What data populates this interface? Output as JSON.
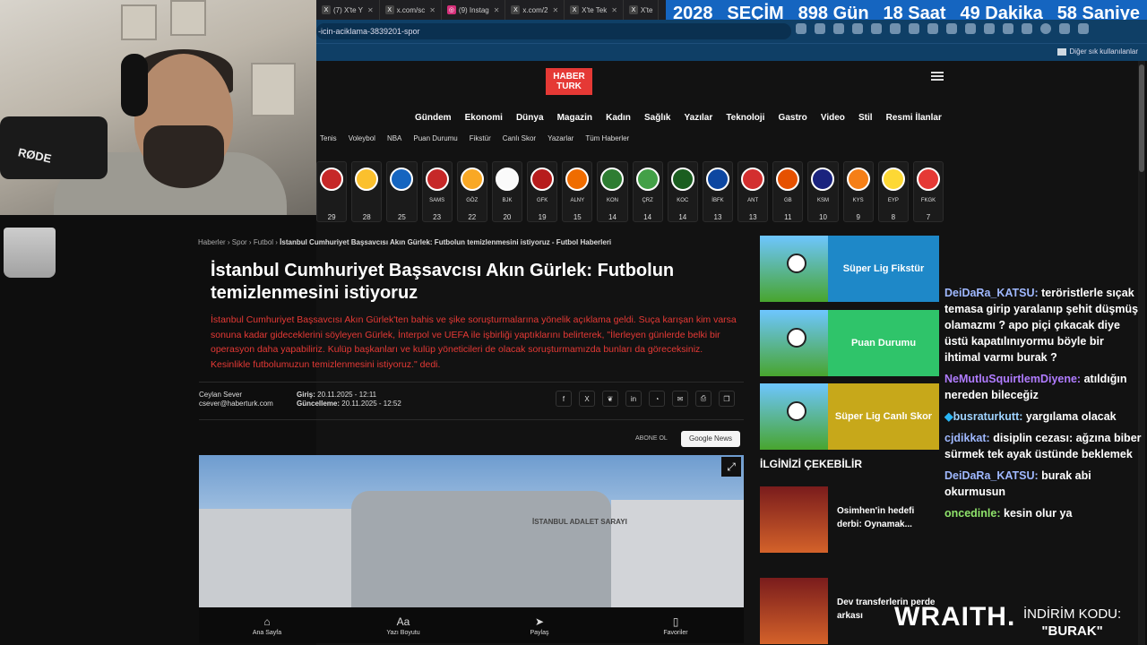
{
  "tabs": [
    {
      "icon": "x-icon",
      "label": "(7) X'te Y"
    },
    {
      "icon": "x-icon",
      "label": "x.com/sc"
    },
    {
      "icon": "instagram-icon",
      "label": "(9) Instag"
    },
    {
      "icon": "x-icon",
      "label": "x.com/2"
    },
    {
      "icon": "x-icon",
      "label": "X'te Tek"
    },
    {
      "icon": "x-icon",
      "label": "X'te"
    }
  ],
  "countdown": [
    "2028",
    "SEÇİM",
    "898 Gün",
    "18 Saat",
    "49 Dakika",
    "58 Saniye"
  ],
  "address": {
    "url": "-icin-aciklama-3839201-spor"
  },
  "bookmarks": {
    "other": "Diğer sık kullanılanlar"
  },
  "site": {
    "logo": "HABER TURK",
    "main_nav": [
      "Gündem",
      "Ekonomi",
      "Dünya",
      "Magazin",
      "Kadın",
      "Sağlık",
      "Yazılar",
      "Teknoloji",
      "Gastro",
      "Video",
      "Stil",
      "Resmi İlanlar"
    ],
    "sub_nav": [
      "Tenis",
      "Voleybol",
      "NBA",
      "Puan Durumu",
      "Fikstür",
      "Canlı Skor",
      "Yazarlar",
      "Tüm Haberler"
    ],
    "teams": [
      {
        "abbr": "",
        "pts": "29",
        "color": "#c62828"
      },
      {
        "abbr": "",
        "pts": "28",
        "color": "#fbc02d"
      },
      {
        "abbr": "",
        "pts": "25",
        "color": "#1565c0"
      },
      {
        "abbr": "SAMS",
        "pts": "23",
        "color": "#c62828"
      },
      {
        "abbr": "GÖZ",
        "pts": "22",
        "color": "#f9a825"
      },
      {
        "abbr": "BJK",
        "pts": "20",
        "color": "#fafafa"
      },
      {
        "abbr": "GFK",
        "pts": "19",
        "color": "#b71c1c"
      },
      {
        "abbr": "ALNY",
        "pts": "15",
        "color": "#ef6c00"
      },
      {
        "abbr": "KON",
        "pts": "14",
        "color": "#2e7d32"
      },
      {
        "abbr": "ÇRZ",
        "pts": "14",
        "color": "#43a047"
      },
      {
        "abbr": "KOC",
        "pts": "14",
        "color": "#1b5e20"
      },
      {
        "abbr": "İBFK",
        "pts": "13",
        "color": "#0d47a1"
      },
      {
        "abbr": "ANT",
        "pts": "13",
        "color": "#d32f2f"
      },
      {
        "abbr": "GB",
        "pts": "11",
        "color": "#e65100"
      },
      {
        "abbr": "KSM",
        "pts": "10",
        "color": "#1a237e"
      },
      {
        "abbr": "KYS",
        "pts": "9",
        "color": "#f57f17"
      },
      {
        "abbr": "EYP",
        "pts": "8",
        "color": "#fdd835"
      },
      {
        "abbr": "FKGK",
        "pts": "7",
        "color": "#e53935"
      }
    ],
    "breadcrumb": [
      "Haberler",
      "Spor",
      "Futbol"
    ],
    "breadcrumb_current": "İstanbul Cumhuriyet Başsavcısı Akın Gürlek: Futbolun temizlenmesini istiyoruz - Futbol Haberleri",
    "title": "İstanbul Cumhuriyet Başsavcısı Akın Gürlek: Futbolun temizlenmesini istiyoruz",
    "lead": "İstanbul Cumhuriyet Başsavcısı Akın Gürlek'ten bahis ve şike soruşturmalarına yönelik açıklama geldi. Suça karışan kim varsa sonuna kadar gideceklerini söyleyen Gürlek, İnterpol ve UEFA ile işbirliği yaptıklarını belirterek, \"İlerleyen günlerde belki bir operasyon daha yapabiliriz. Kulüp başkanları ve kulüp yöneticileri de olacak soruşturmamızda bunları da göreceksiniz. Kesinlikle futbolumuzun temizlenmesini istiyoruz.\" dedi.",
    "author": "Ceylan Sever",
    "author_email": "csever@haberturk.com",
    "published_label": "Giriş:",
    "published": "20.11.2025 - 12:11",
    "updated_label": "Güncelleme:",
    "updated": "20.11.2025 - 12:52",
    "subscribe": "ABONE OL",
    "google_news": "Google News",
    "photo_sign": "İSTANBUL ADALET SARAYI",
    "side_cards": [
      {
        "label": "Süper Lig Fikstür",
        "color": "#1e88c8"
      },
      {
        "label": "Puan Durumu",
        "color": "#2fc46a"
      },
      {
        "label": "Süper Lig Canlı Skor",
        "color": "#c7a81a"
      }
    ],
    "related_title": "İLGİNİZİ ÇEKEBİLİR",
    "related": [
      "Osimhen'in hedefi derbi: Oynamak...",
      "Dev transferlerin perde arkası"
    ],
    "bottom_bar": [
      "Ana Sayfa",
      "Yazı Boyutu",
      "Paylaş",
      "Favoriler"
    ]
  },
  "chat": [
    {
      "user": "DeiDaRa_KATSU:",
      "text": " teröristlerle sıçak temasa girip yaralanıp şehit düşmüş olamazmı ? apo piçi çıkacak diye üstü kapatılınıyormu böyle bir ihtimal varmı burak ?",
      "color": "#9fb8ff"
    },
    {
      "user": "NeMutluSquirtlemDiyene:",
      "text": " atıldığın nereden bileceğiz",
      "color": "#b07cff"
    },
    {
      "user": "busraturkutt:",
      "text": " yargılama olacak",
      "color": "#9fd3ff"
    },
    {
      "user": "cjdikkat:",
      "text": " disiplin cezası: ağzına biber sürmek tek ayak üstünde beklemek",
      "color": "#9fb8ff"
    },
    {
      "user": "DeiDaRa_KATSU:",
      "text": " burak abi okurmusun",
      "color": "#9fb8ff"
    },
    {
      "user": "oncedinle:",
      "text": " kesin olur ya",
      "color": "#8fe36b"
    }
  ],
  "sponsor": {
    "brand": "WRAITH.",
    "promo_label": "İNDİRİM KODU:",
    "promo_code": "\"BURAK\""
  }
}
